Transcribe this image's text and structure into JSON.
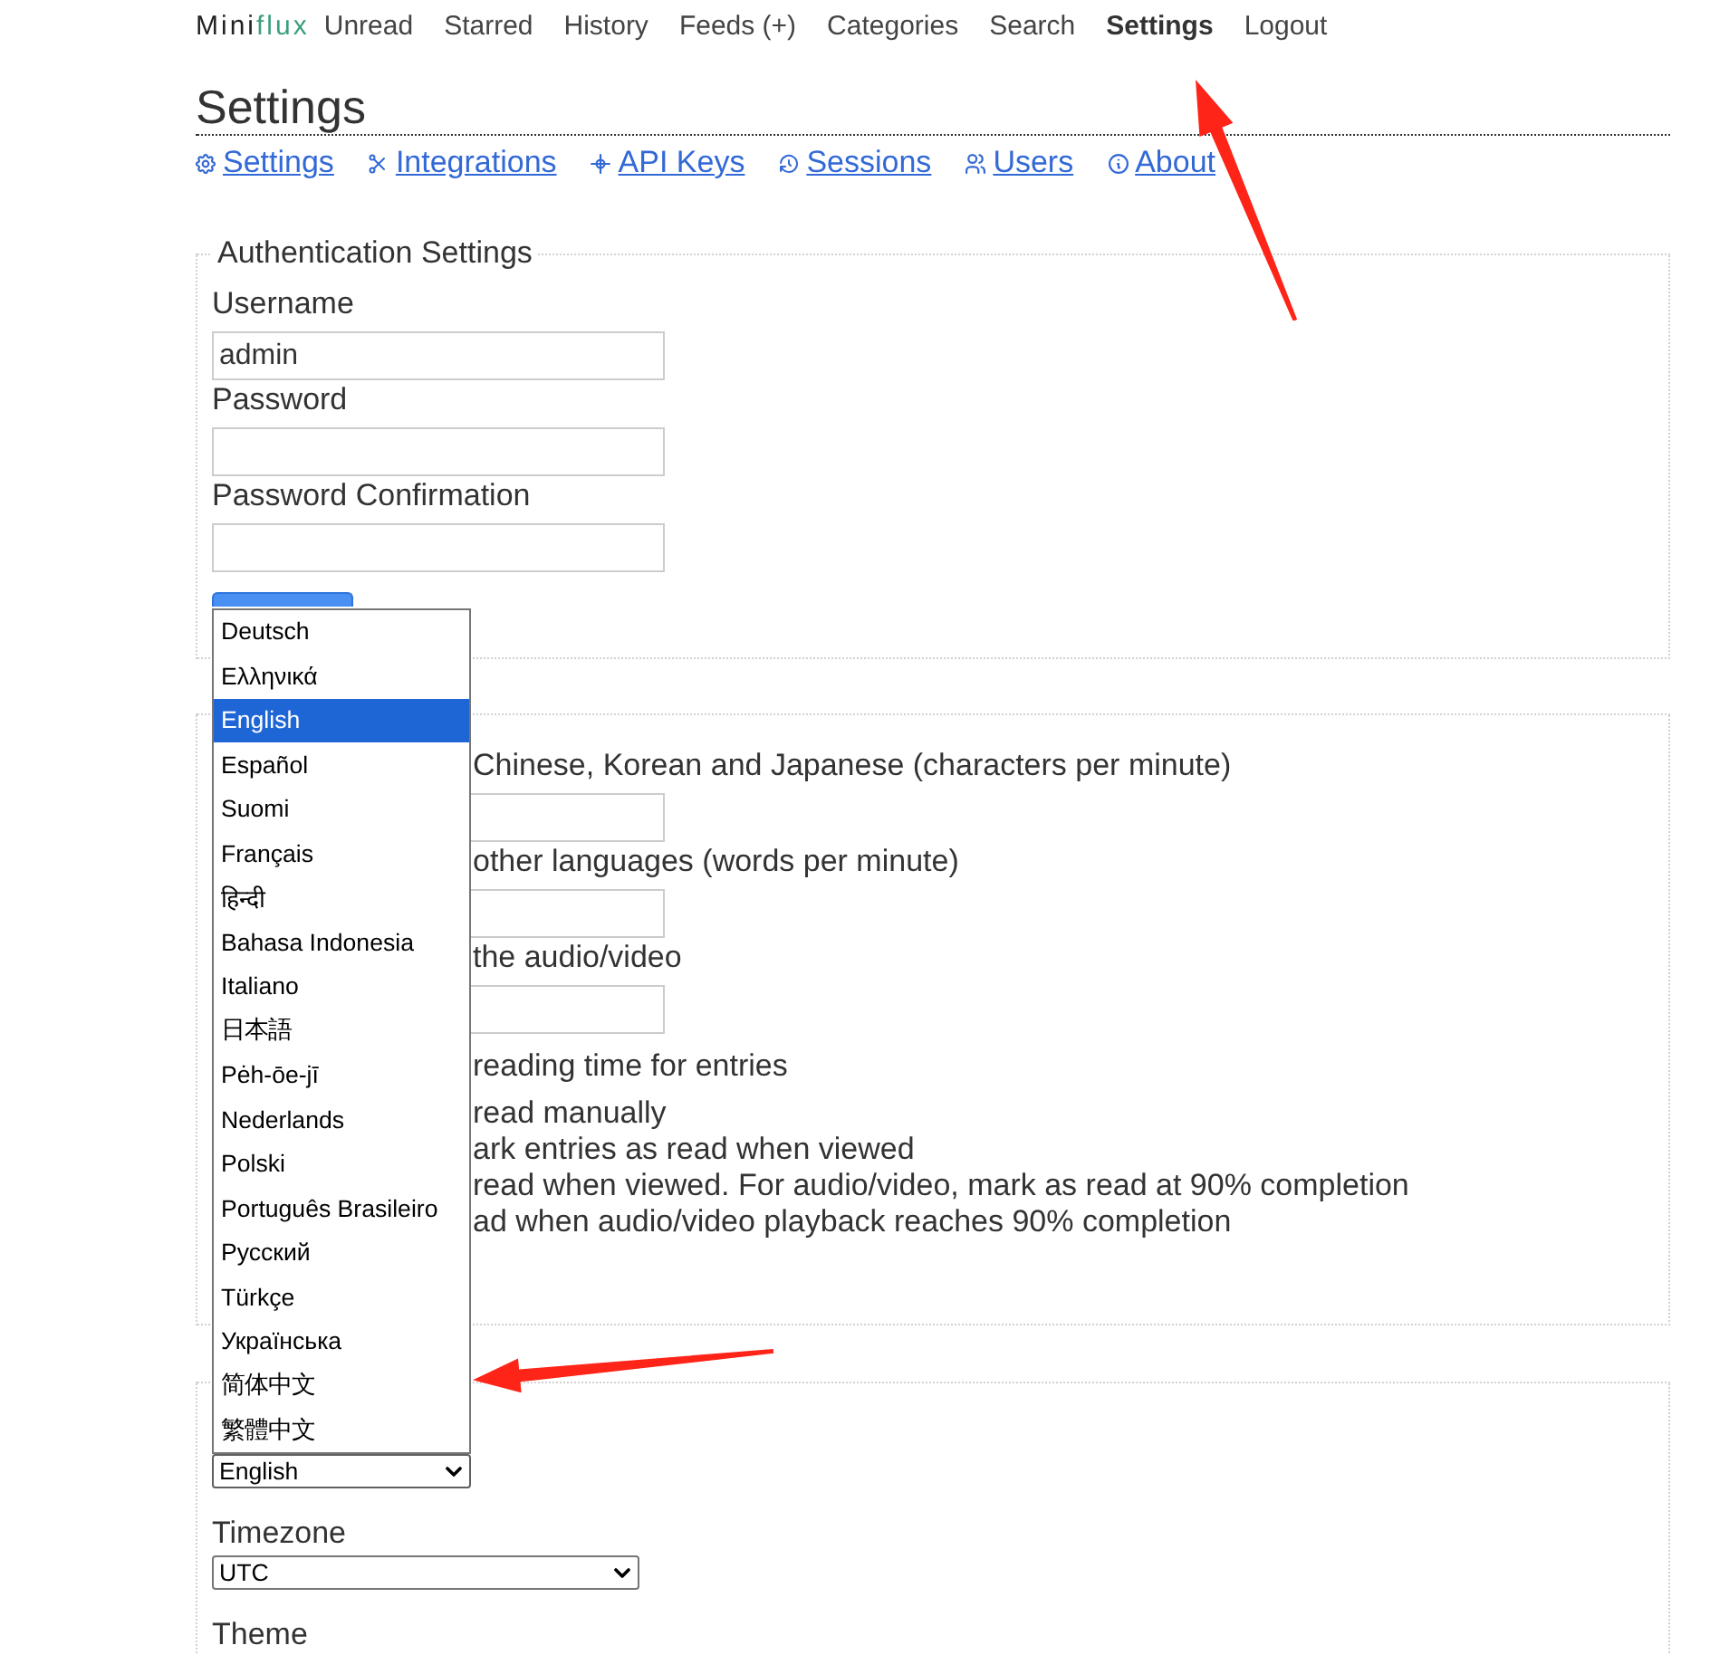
{
  "nav": {
    "logo": {
      "primary": "Mini",
      "accent": "flux"
    },
    "items": [
      {
        "label": "Unread",
        "selected": false
      },
      {
        "label": "Starred",
        "selected": false
      },
      {
        "label": "History",
        "selected": false
      },
      {
        "label": "Feeds (+)",
        "selected": false
      },
      {
        "label": "Categories",
        "selected": false
      },
      {
        "label": "Search",
        "selected": false
      },
      {
        "label": "Settings",
        "selected": true
      },
      {
        "label": "Logout",
        "selected": false
      }
    ]
  },
  "page_title": "Settings",
  "subnav": [
    "Settings",
    "Integrations",
    "API Keys",
    "Sessions",
    "Users",
    "About"
  ],
  "sections": [
    {
      "legend": "Authentication Settings",
      "rows": [
        {
          "kind": "label",
          "text": "Username"
        },
        {
          "kind": "input",
          "value": "admin"
        },
        {
          "kind": "label",
          "text": "Password"
        },
        {
          "kind": "input"
        },
        {
          "kind": "label",
          "text": "Password Confirmation"
        },
        {
          "kind": "input"
        },
        {
          "kind": "button"
        }
      ]
    },
    {
      "rows": [
        {
          "kind": "label",
          "text": "Chinese, Korean and Japanese (characters per minute)"
        },
        {
          "kind": "input"
        },
        {
          "kind": "label",
          "text": "other languages (words per minute)"
        },
        {
          "kind": "input"
        },
        {
          "kind": "label",
          "text": "the audio/video"
        },
        {
          "kind": "input"
        },
        {
          "kind": "checkbox_label",
          "text": "reading time for entries"
        },
        {
          "kind": "radio_label",
          "text": "read manually"
        },
        {
          "kind": "radio_label",
          "text": "ark entries as read when viewed"
        },
        {
          "kind": "radio_label",
          "text": "read when viewed. For audio/video, mark as read at 90% completion"
        },
        {
          "kind": "radio_label",
          "text": "ad when audio/video playback reaches 90% completion"
        }
      ]
    },
    {
      "rows": [
        {
          "kind": "select",
          "value": "English",
          "expanded": true,
          "options": [
            {
              "label": "Deutsch",
              "selected": false
            },
            {
              "label": "Ελληνικά",
              "selected": false
            },
            {
              "label": "English",
              "selected": true
            },
            {
              "label": "Español",
              "selected": false
            },
            {
              "label": "Suomi",
              "selected": false
            },
            {
              "label": "Français",
              "selected": false
            },
            {
              "label": "हिन्दी",
              "selected": false
            },
            {
              "label": "Bahasa Indonesia",
              "selected": false
            },
            {
              "label": "Italiano",
              "selected": false
            },
            {
              "label": "日本語",
              "selected": false
            },
            {
              "label": "Pėh-ōe-jī",
              "selected": false
            },
            {
              "label": "Nederlands",
              "selected": false
            },
            {
              "label": "Polski",
              "selected": false
            },
            {
              "label": "Português Brasileiro",
              "selected": false
            },
            {
              "label": "Русский",
              "selected": false
            },
            {
              "label": "Türkçe",
              "selected": false
            },
            {
              "label": "Українська",
              "selected": false
            },
            {
              "label": "简体中文",
              "selected": false
            },
            {
              "label": "繁體中文",
              "selected": false
            }
          ]
        },
        {
          "kind": "label",
          "text": "Timezone"
        },
        {
          "kind": "select",
          "value": "UTC",
          "expanded": false
        },
        {
          "kind": "label",
          "text": "Theme"
        }
      ]
    }
  ],
  "annotations": [
    {
      "kind": "arrow"
    },
    {
      "kind": "arrow"
    }
  ]
}
